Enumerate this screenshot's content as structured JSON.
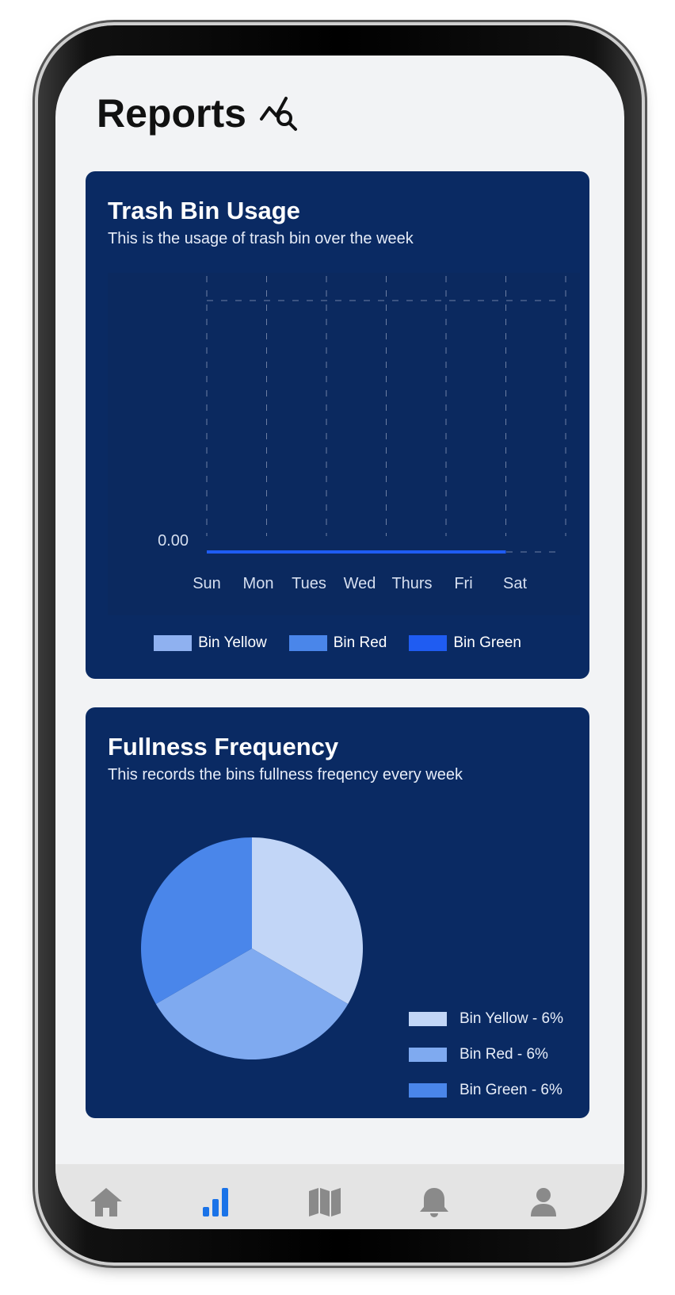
{
  "header": {
    "title": "Reports",
    "icon": "chart-search-icon"
  },
  "usage_card": {
    "title": "Trash Bin Usage",
    "subtitle": "This is the usage of trash bin over the week"
  },
  "fullness_card": {
    "title": "Fullness Frequency",
    "subtitle": "This records the bins fullness freqency every week"
  },
  "chart_data": [
    {
      "type": "line",
      "categories": [
        "Sun",
        "Mon",
        "Tues",
        "Wed",
        "Thurs",
        "Fri",
        "Sat"
      ],
      "y_tick_labels": [
        "0.00"
      ],
      "grid": true,
      "legend_position": "bottom",
      "series": [
        {
          "name": "Bin Yellow",
          "color": "#8fb1f0",
          "values": [
            0,
            0,
            0,
            0,
            0,
            0
          ]
        },
        {
          "name": "Bin Red",
          "color": "#4a86ea",
          "values": [
            0,
            0,
            0,
            0,
            0,
            0
          ]
        },
        {
          "name": "Bin Green",
          "color": "#1f5cf2",
          "values": [
            0,
            0,
            0,
            0,
            0,
            0
          ]
        }
      ]
    },
    {
      "type": "pie",
      "legend_position": "bottom-right",
      "slices": [
        {
          "name": "Bin Yellow",
          "label": "Bin Yellow - 6%",
          "value": 6,
          "color": "#c2d6f7"
        },
        {
          "name": "Bin Red",
          "label": "Bin Red - 6%",
          "value": 6,
          "color": "#7faaf0"
        },
        {
          "name": "Bin Green",
          "label": "Bin Green - 6%",
          "value": 6,
          "color": "#4a86ea"
        }
      ]
    }
  ],
  "nav": {
    "active_color": "#1a73e8",
    "inactive_color": "#8a8a8a",
    "items": [
      {
        "icon": "home-icon",
        "active": false
      },
      {
        "icon": "bar-chart-icon",
        "active": true
      },
      {
        "icon": "map-icon",
        "active": false
      },
      {
        "icon": "bell-icon",
        "active": false
      },
      {
        "icon": "user-icon",
        "active": false
      }
    ]
  }
}
